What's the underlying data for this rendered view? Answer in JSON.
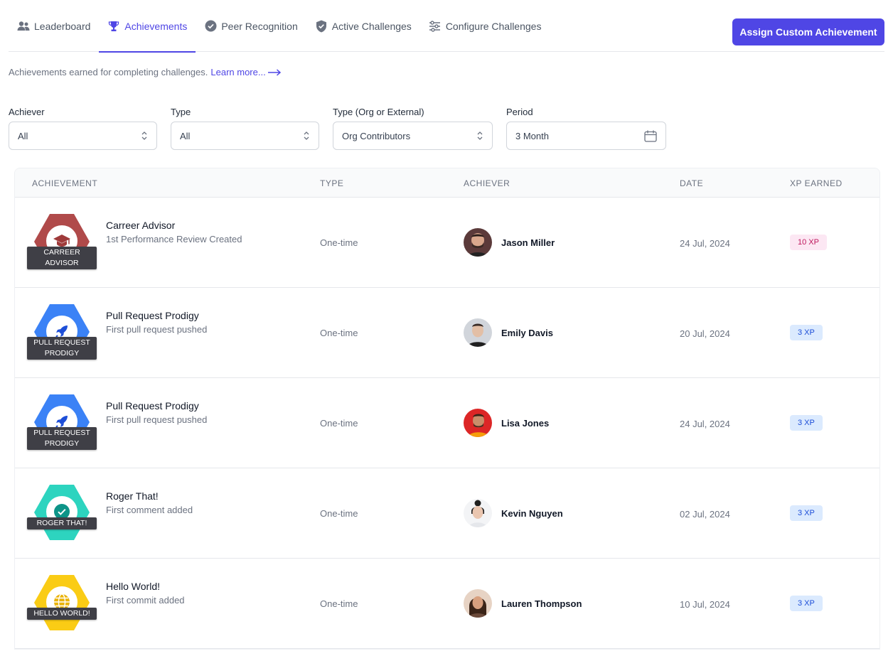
{
  "tabs": [
    {
      "label": "Leaderboard",
      "icon": "users-icon",
      "active": false
    },
    {
      "label": "Achievements",
      "icon": "trophy-icon",
      "active": true
    },
    {
      "label": "Peer Recognition",
      "icon": "badge-check-icon",
      "active": false
    },
    {
      "label": "Active Challenges",
      "icon": "shield-check-icon",
      "active": false
    },
    {
      "label": "Configure Challenges",
      "icon": "sliders-icon",
      "active": false
    }
  ],
  "assign_button": "Assign Custom Achievement",
  "intro": {
    "text": "Achievements earned for completing challenges.",
    "link": "Learn more..."
  },
  "filters": {
    "achiever": {
      "label": "Achiever",
      "value": "All"
    },
    "type": {
      "label": "Type",
      "value": "All"
    },
    "org": {
      "label": "Type (Org or External)",
      "value": "Org Contributors"
    },
    "period": {
      "label": "Period",
      "value": "3 Month"
    }
  },
  "columns": [
    "Achievement",
    "Type",
    "Achiever",
    "Date",
    "XP Earned"
  ],
  "rows": [
    {
      "title": "Carreer Advisor",
      "desc": "1st Performance Review Created",
      "badge": "CARREER ADVISOR",
      "badge_color": "#b04a4a",
      "icon": "graduation-cap-icon",
      "type": "One-time",
      "achiever": "Jason Miller",
      "date": "24 Jul, 2024",
      "xp": "10 XP",
      "xp_style": "pink"
    },
    {
      "title": "Pull Request Prodigy",
      "desc": "First pull request pushed",
      "badge": "PULL REQUEST PRODIGY",
      "badge_color": "#3b82f6",
      "icon": "rocket-icon",
      "type": "One-time",
      "achiever": "Emily Davis",
      "date": "20 Jul, 2024",
      "xp": "3 XP",
      "xp_style": "blue"
    },
    {
      "title": "Pull Request Prodigy",
      "desc": "First pull request pushed",
      "badge": "PULL REQUEST PRODIGY",
      "badge_color": "#3b82f6",
      "icon": "rocket-icon",
      "type": "One-time",
      "achiever": "Lisa Jones",
      "date": "24 Jul, 2024",
      "xp": "3 XP",
      "xp_style": "blue"
    },
    {
      "title": "Roger That!",
      "desc": "First comment added",
      "badge": "ROGER THAT!",
      "badge_color": "#2dd4bf",
      "icon": "check-circle-icon",
      "type": "One-time",
      "achiever": "Kevin Nguyen",
      "date": "02 Jul, 2024",
      "xp": "3 XP",
      "xp_style": "blue"
    },
    {
      "title": "Hello World!",
      "desc": "First commit added",
      "badge": "HELLO WORLD!",
      "badge_color": "#facc15",
      "icon": "globe-icon",
      "type": "One-time",
      "achiever": "Lauren Thompson",
      "date": "10 Jul, 2024",
      "xp": "3 XP",
      "xp_style": "blue"
    }
  ]
}
